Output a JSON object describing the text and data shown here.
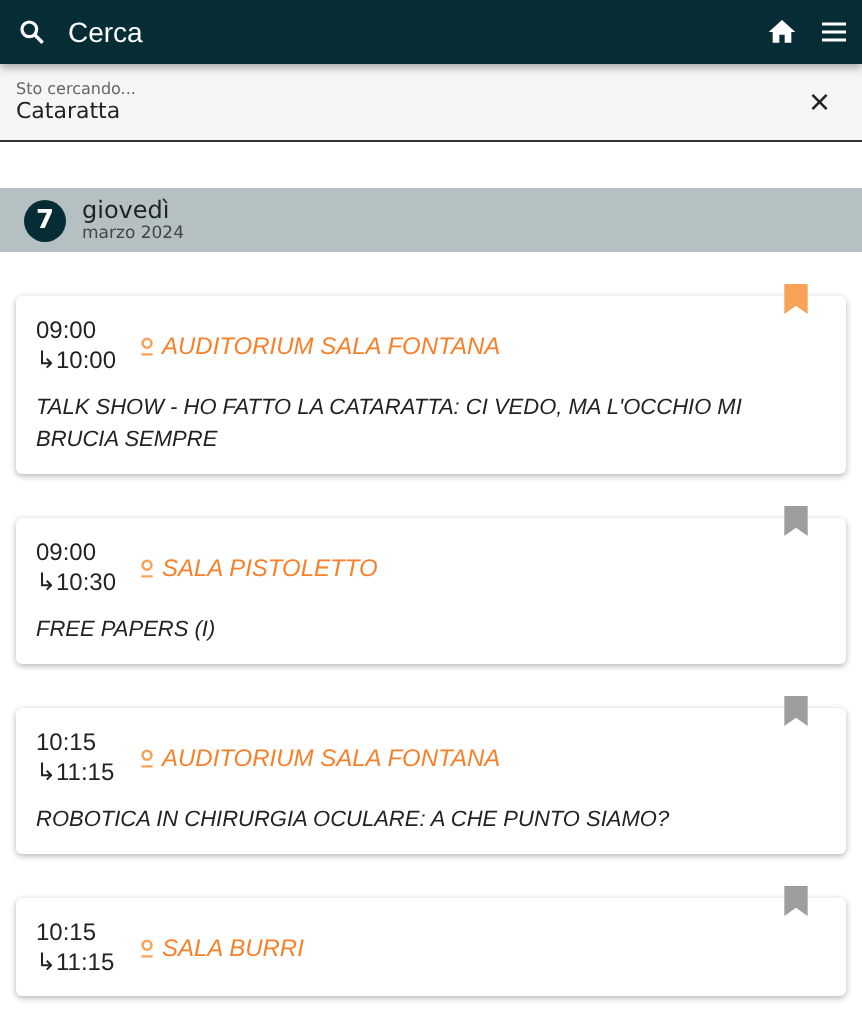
{
  "app_bar": {
    "title": "Cerca"
  },
  "search": {
    "placeholder": "Sto cercando...",
    "value": "Cataratta",
    "clear": "×"
  },
  "day": {
    "number": "7",
    "weekday": "giovedì",
    "month": "marzo 2024"
  },
  "events": [
    {
      "start": "09:00",
      "end": "↳10:00",
      "room": "AUDITORIUM SALA FONTANA",
      "title": "TALK SHOW - HO FATTO LA CATARATTA: CI VEDO, MA L'OCCHIO MI BRUCIA SEMPRE",
      "bookmarked": true
    },
    {
      "start": "09:00",
      "end": "↳10:30",
      "room": "SALA PISTOLETTO",
      "title": "FREE PAPERS (I)",
      "bookmarked": false
    },
    {
      "start": "10:15",
      "end": "↳11:15",
      "room": "AUDITORIUM SALA FONTANA",
      "title": "ROBOTICA IN CHIRURGIA OCULARE: A CHE PUNTO SIAMO?",
      "bookmarked": false
    },
    {
      "start": "10:15",
      "end": "↳11:15",
      "room": "SALA BURRI",
      "bookmarked": false
    }
  ]
}
